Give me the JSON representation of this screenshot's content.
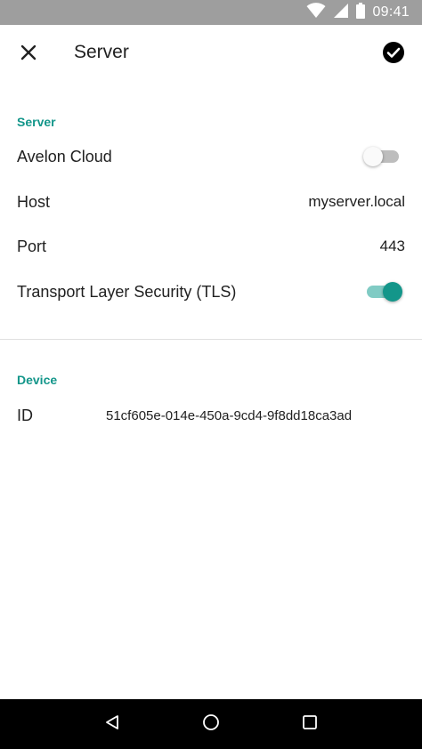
{
  "status_bar": {
    "time": "09:41",
    "icons": [
      "wifi-icon",
      "signal-icon",
      "battery-icon"
    ],
    "background": "#9e9e9e"
  },
  "app_bar": {
    "title": "Server",
    "close_icon": "close-icon",
    "save_icon": "check-circle-icon"
  },
  "server_section": {
    "header": "Server",
    "avelon_cloud": {
      "label": "Avelon Cloud",
      "enabled": false
    },
    "host": {
      "label": "Host",
      "value": "myserver.local"
    },
    "port": {
      "label": "Port",
      "value": "443"
    },
    "tls": {
      "label": "Transport Layer Security (TLS)",
      "enabled": true
    }
  },
  "device_section": {
    "header": "Device",
    "id": {
      "label": "ID",
      "value": "51cf605e-014e-450a-9cd4-9f8dd18ca3ad"
    }
  },
  "nav_bar": {
    "buttons": [
      "back-icon",
      "home-icon",
      "recents-icon"
    ]
  },
  "colors": {
    "accent": "#13968a",
    "accent_light": "#80cbc4",
    "switch_off_track": "#bdbdbd",
    "text": "#212121",
    "nav_bar": "#000000"
  }
}
